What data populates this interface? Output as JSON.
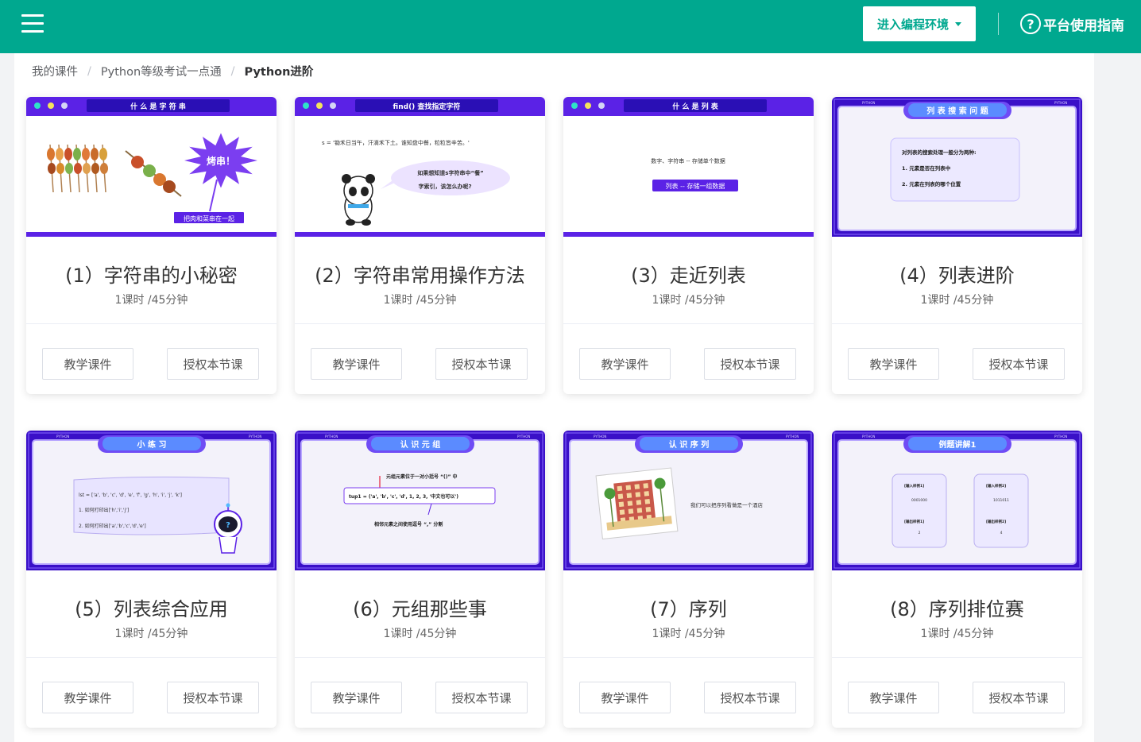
{
  "header": {
    "enter_label": "进入编程环境",
    "guide_label": "平台使用指南",
    "guide_icon": "?"
  },
  "breadcrumb": {
    "items": [
      "我的课件",
      "Python等级考试一点通"
    ],
    "current": "Python进阶"
  },
  "actions": {
    "teach": "教学课件",
    "authorize": "授权本节课"
  },
  "cards": [
    {
      "title": "(1）字符串的小秘密",
      "duration": "1课时 /45分钟",
      "slide": {
        "style": "window",
        "heading": "什 么 是 字 符 串",
        "lines": [],
        "burst": "烤串！",
        "tag": "把肉和菜串在一起"
      }
    },
    {
      "title": "(2）字符串常用操作方法",
      "duration": "1课时 /45分钟",
      "slide": {
        "style": "window",
        "heading": "find() 查找指定字符",
        "lines": [
          "s = '锄禾日当午，汗滴禾下土。谁知盘中餐，粒粒皆辛苦。'",
          "如果想知道s字符串中“餐”",
          "字索引，该怎么办呢?"
        ]
      }
    },
    {
      "title": "(3）走近列表",
      "duration": "1课时 /45分钟",
      "slide": {
        "style": "window",
        "heading": "什 么 是 列 表",
        "lines": [
          "数字、字符串 -- 存储单个数据"
        ],
        "tag": "列表 -- 存储一组数据"
      }
    },
    {
      "title": "(4）列表进阶",
      "duration": "1课时 /45分钟",
      "slide": {
        "style": "frame",
        "corner_left": "PYTHON",
        "corner_right": "PYTHON",
        "heading": "列 表 搜 索 问 题",
        "lines": [
          "对列表的搜索处理一般分为两种:",
          "1. 元素是否在列表中",
          "2. 元素在列表的哪个位置"
        ]
      }
    },
    {
      "title": "(5）列表综合应用",
      "duration": "1课时 /45分钟",
      "slide": {
        "style": "frame",
        "corner_left": "PYTHON",
        "corner_right": "PYTHON",
        "heading": "小 练 习",
        "lines": [
          "lst = ['a', 'b', 'c', 'd', 'e', 'f', 'g', 'h', 'i', 'j', 'k']",
          "1. 如何打印出['h','i','j']",
          "2. 如何打印出['a','b','c','d','e']"
        ],
        "mark": "?"
      }
    },
    {
      "title": "(6）元组那些事",
      "duration": "1课时 /45分钟",
      "slide": {
        "style": "frame",
        "corner_left": "PYTHON",
        "corner_right": "PYTHON",
        "heading": "认 识 元 组",
        "lines": [
          "元组元素位于一对小括号 “()” 中",
          "tup1 = ('a', 'b', 'c', 'd', 1, 2, 3, '中文也可以')",
          "相邻元素之间使用逗号 “,” 分割"
        ]
      }
    },
    {
      "title": "(7）序列",
      "duration": "1课时 /45分钟",
      "slide": {
        "style": "frame",
        "corner_left": "PYTHON",
        "corner_right": "PYTHON",
        "heading": "认 识 序 列",
        "lines": [
          "我们可以把序列看做是一个酒店"
        ]
      }
    },
    {
      "title": "(8）序列排位赛",
      "duration": "1课时 /45分钟",
      "slide": {
        "style": "frame",
        "corner_left": "PYTHON",
        "corner_right": "PYTHON",
        "heading": "例题讲解1",
        "boxes": [
          {
            "label1": "[输入样例1]",
            "value1": "0001000",
            "label2": "[输出样例1]",
            "value2": "2"
          },
          {
            "label1": "[输入样例2]",
            "value1": "1011011",
            "label2": "[输出样例2]",
            "value2": "4"
          }
        ]
      }
    }
  ]
}
